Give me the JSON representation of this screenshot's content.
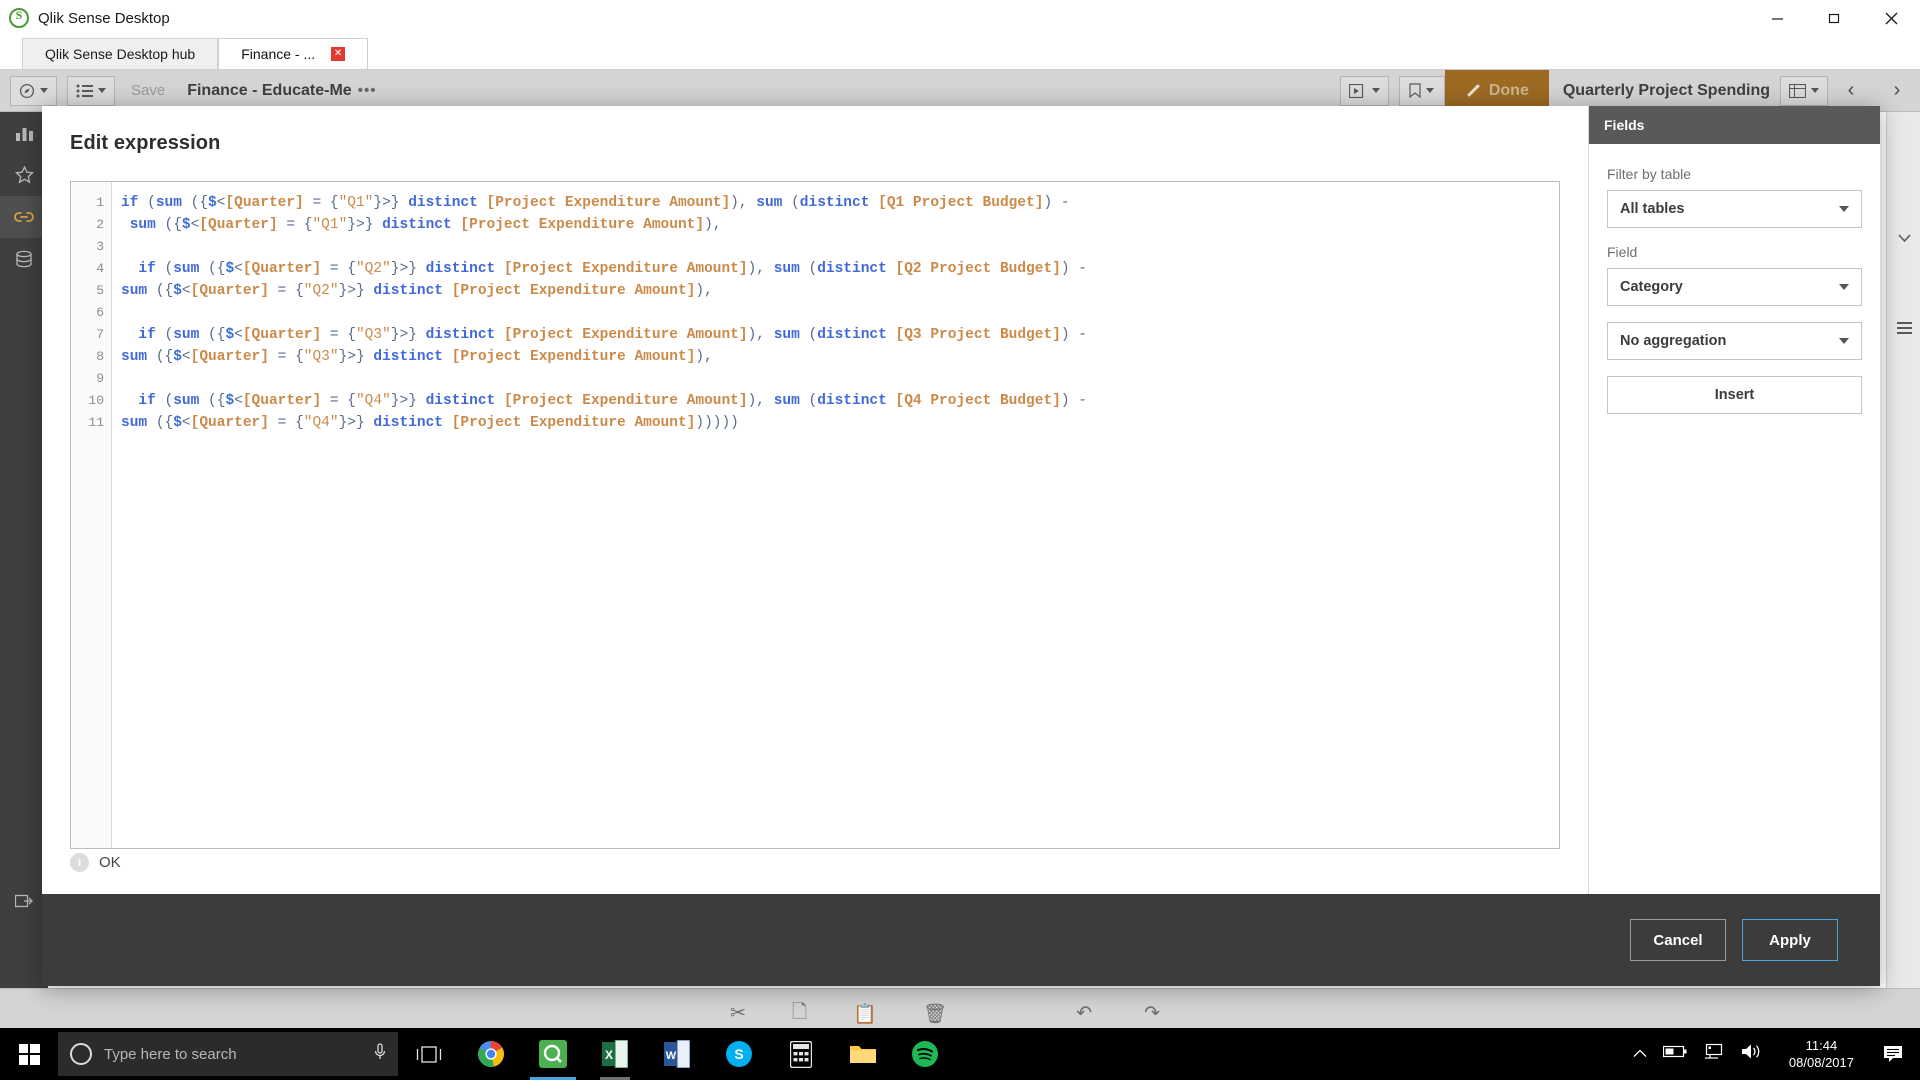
{
  "window": {
    "title": "Qlik Sense Desktop",
    "logo_icon": "qlik-logo-icon",
    "minimize_icon": "minimize-icon",
    "maximize_icon": "maximize-icon",
    "close_icon": "close-icon"
  },
  "tabs": [
    {
      "label": "Qlik Sense Desktop hub",
      "active": false
    },
    {
      "label": "Finance - ...",
      "active": true,
      "close_label": "✕"
    }
  ],
  "toolbar": {
    "nav_icon": "compass-icon",
    "sheet_icon": "sheet-list-icon",
    "save_label": "Save",
    "doc_title": "Finance - Educate-Me",
    "doc_more": "•••",
    "present_icon": "present-icon",
    "bookmark_icon": "bookmark-icon",
    "done_label": "Done",
    "done_icon": "pencil-icon",
    "chart_title": "Quarterly Project Spending",
    "grid_icon": "grid-icon",
    "prev_label": "‹",
    "next_label": "›"
  },
  "left_rail": [
    {
      "name": "chart-icon"
    },
    {
      "name": "star-icon"
    },
    {
      "name": "link-icon",
      "selected": true
    },
    {
      "name": "database-icon"
    },
    {
      "name": "export-icon"
    }
  ],
  "right_rail": [
    {
      "name": "chevron-down-icon"
    },
    {
      "name": "list-icon"
    }
  ],
  "bottom_strip": {
    "cut_icon": "scissors-icon",
    "copy_icon": "copy-icon",
    "paste_icon": "paste-icon",
    "delete_icon": "trash-icon",
    "undo_icon": "undo-icon",
    "redo_icon": "redo-icon"
  },
  "dialog": {
    "heading": "Edit expression",
    "status_icon": "info-icon",
    "status_text": "OK",
    "cancel_label": "Cancel",
    "apply_label": "Apply",
    "accent_color": "#4aa3df",
    "footer_color": "#3c3c3c"
  },
  "expression": {
    "line_numbers": [
      1,
      2,
      3,
      4,
      5,
      6,
      7,
      8,
      9,
      10,
      11
    ],
    "lines": [
      "if (sum ({$<[Quarter] = {\"Q1\"}>} distinct [Project Expenditure Amount]), sum (distinct [Q1 Project Budget]) -",
      " sum ({$<[Quarter] = {\"Q1\"}>} distinct [Project Expenditure Amount]),",
      "",
      "  if (sum ({$<[Quarter] = {\"Q2\"}>} distinct [Project Expenditure Amount]), sum (distinct [Q2 Project Budget]) -",
      "sum ({$<[Quarter] = {\"Q2\"}>} distinct [Project Expenditure Amount]),",
      "",
      "  if (sum ({$<[Quarter] = {\"Q3\"}>} distinct [Project Expenditure Amount]), sum (distinct [Q3 Project Budget]) -",
      "sum ({$<[Quarter] = {\"Q3\"}>} distinct [Project Expenditure Amount]),",
      "",
      "  if (sum ({$<[Quarter] = {\"Q4\"}>} distinct [Project Expenditure Amount]), sum (distinct [Q4 Project Budget]) -",
      "sum ({$<[Quarter] = {\"Q4\"}>} distinct [Project Expenditure Amount])))))"
    ],
    "syntax_colors": {
      "keyword": "#4169d8",
      "field": "#cc8a4a",
      "dollar": "#3b6fd4",
      "punctuation": "#5a6b8c"
    }
  },
  "fields_panel": {
    "header": "Fields",
    "filter_label": "Filter by table",
    "filter_value": "All tables",
    "field_label": "Field",
    "field_value": "Category",
    "aggregation_value": "No aggregation",
    "insert_label": "Insert"
  },
  "taskbar": {
    "start_icon": "windows-start-icon",
    "cortana_icon": "cortana-circle-icon",
    "search_placeholder": "Type here to search",
    "mic_icon": "microphone-icon",
    "taskview_icon": "task-view-icon",
    "apps": [
      {
        "name": "chrome-icon"
      },
      {
        "name": "qlik-sense-icon",
        "active": true
      },
      {
        "name": "excel-icon",
        "open": true
      },
      {
        "name": "word-icon"
      },
      {
        "name": "skype-icon"
      },
      {
        "name": "calculator-icon"
      },
      {
        "name": "file-explorer-icon"
      },
      {
        "name": "spotify-icon"
      }
    ],
    "tray": {
      "expand_icon": "chevron-up-icon",
      "battery_icon": "battery-icon",
      "network_icon": "network-icon",
      "volume_icon": "volume-icon",
      "notification_icon": "notification-icon"
    },
    "time": "11:44",
    "date": "08/08/2017"
  }
}
